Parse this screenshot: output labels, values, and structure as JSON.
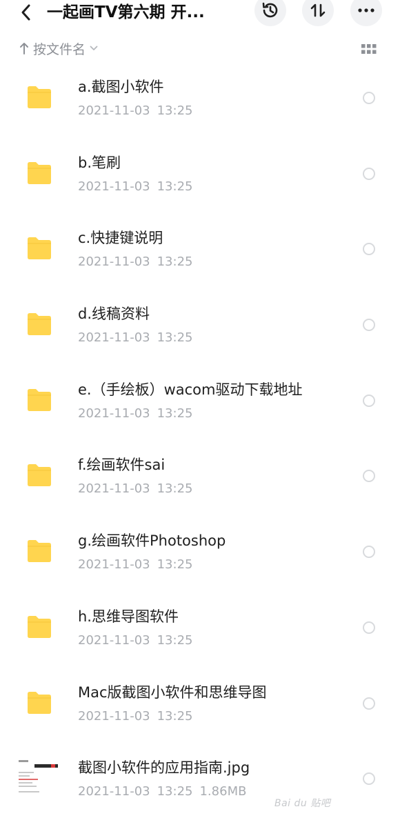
{
  "header": {
    "title": "一起画TV第六期 开...",
    "icons": {
      "back": "chevron-left-icon",
      "history": "history-icon",
      "sort": "sort-arrows-icon",
      "more": "more-dots-icon"
    }
  },
  "sort_bar": {
    "label": "按文件名",
    "icons": {
      "direction": "arrow-up-icon",
      "dropdown": "chevron-down-icon",
      "view": "grid-view-icon"
    }
  },
  "colors": {
    "folder": "#FFD54F",
    "meta_text": "#A9ACB1",
    "sort_text": "#8D9096",
    "button_bg": "#F1F2F4"
  },
  "files": [
    {
      "name": "a.截图小软件",
      "date": "2021-11-03",
      "time": "13:25",
      "size": "",
      "type": "folder"
    },
    {
      "name": "b.笔刷",
      "date": "2021-11-03",
      "time": "13:25",
      "size": "",
      "type": "folder"
    },
    {
      "name": "c.快捷键说明",
      "date": "2021-11-03",
      "time": "13:25",
      "size": "",
      "type": "folder"
    },
    {
      "name": "d.线稿资料",
      "date": "2021-11-03",
      "time": "13:25",
      "size": "",
      "type": "folder"
    },
    {
      "name": "e.（手绘板）wacom驱动下载地址",
      "date": "2021-11-03",
      "time": "13:25",
      "size": "",
      "type": "folder"
    },
    {
      "name": "f.绘画软件sai",
      "date": "2021-11-03",
      "time": "13:25",
      "size": "",
      "type": "folder"
    },
    {
      "name": "g.绘画软件Photoshop",
      "date": "2021-11-03",
      "time": "13:25",
      "size": "",
      "type": "folder"
    },
    {
      "name": "h.思维导图软件",
      "date": "2021-11-03",
      "time": "13:25",
      "size": "",
      "type": "folder"
    },
    {
      "name": "Mac版截图小软件和思维导图",
      "date": "2021-11-03",
      "time": "13:25",
      "size": "",
      "type": "folder"
    },
    {
      "name": "截图小软件的应用指南.jpg",
      "date": "2021-11-03",
      "time": "13:25",
      "size": "1.86MB",
      "type": "image"
    }
  ],
  "watermark": "Bai du 贴吧"
}
